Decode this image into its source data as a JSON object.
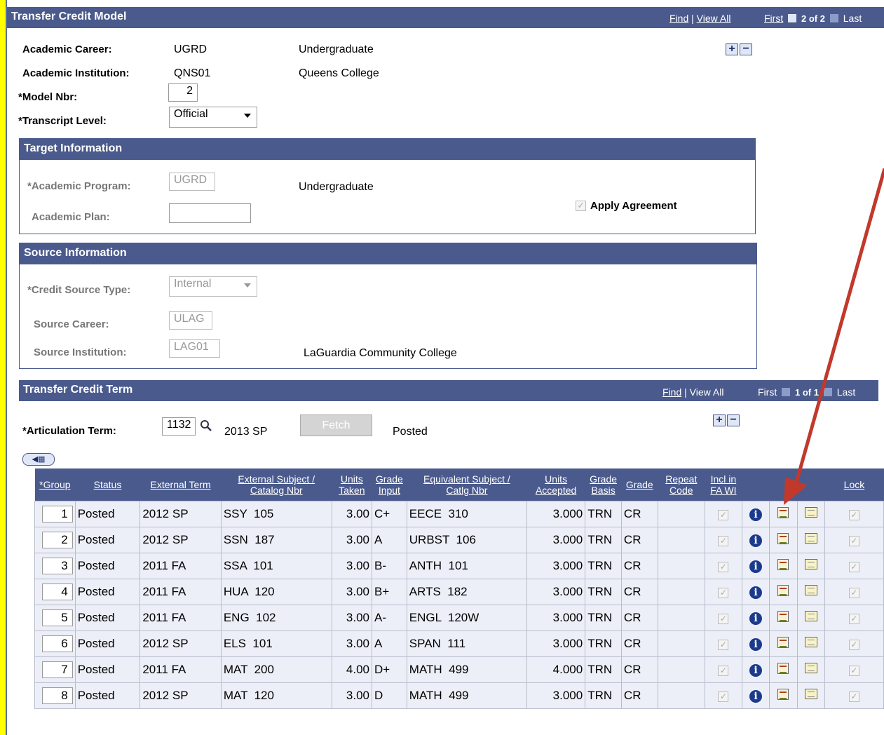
{
  "model": {
    "title": "Transfer Credit Model",
    "nav": {
      "find": "Find",
      "view_all": "View All",
      "first": "First",
      "position": "2 of 2",
      "last": "Last"
    },
    "career_label": "Academic Career:",
    "career_code": "UGRD",
    "career_desc": "Undergraduate",
    "institution_label": "Academic Institution:",
    "institution_code": "QNS01",
    "institution_desc": "Queens College",
    "model_nbr_label": "*Model Nbr:",
    "model_nbr": "2",
    "transcript_label": "*Transcript Level:",
    "transcript_value": "Official"
  },
  "target": {
    "title": "Target Information",
    "program_label": "*Academic Program:",
    "program_code": "UGRD",
    "program_desc": "Undergraduate",
    "plan_label": "Academic Plan:",
    "plan_value": "",
    "apply_label": "Apply Agreement"
  },
  "source": {
    "title": "Source Information",
    "type_label": "*Credit Source Type:",
    "type_value": "Internal",
    "career_label": "Source Career:",
    "career_value": "ULAG",
    "institution_label": "Source Institution:",
    "institution_value": "LAG01",
    "institution_desc": "LaGuardia Community College"
  },
  "term": {
    "title": "Transfer Credit Term",
    "nav": {
      "find": "Find",
      "view_all": "View All",
      "first": "First",
      "position": "1 of 1",
      "last": "Last"
    },
    "articulation_label": "*Articulation Term:",
    "articulation_value": "1132",
    "term_desc": "2013 SP",
    "fetch_label": "Fetch",
    "status": "Posted"
  },
  "grid": {
    "headers": {
      "group": "*Group",
      "status": "Status",
      "ext_term": "External Term",
      "ext_subject_1": "External Subject /",
      "ext_subject_2": "Catalog Nbr",
      "units_1": "Units",
      "units_2": "Taken",
      "grade_input_1": "Grade",
      "grade_input_2": "Input",
      "equiv_1": "Equivalent Subject /",
      "equiv_2": "Catlg Nbr",
      "units_acc_1": "Units",
      "units_acc_2": "Accepted",
      "grade_basis_1": "Grade",
      "grade_basis_2": "Basis",
      "grade": "Grade",
      "repeat_1": "Repeat",
      "repeat_2": "Code",
      "incl_1": "Incl in",
      "incl_2": "FA WI",
      "lock": "Lock"
    },
    "rows": [
      {
        "group": "1",
        "status": "Posted",
        "term": "2012 SP",
        "ext": "SSY  105",
        "units": "3.00",
        "grade_input": "C+",
        "equiv": "EECE  310",
        "accepted": "3.000",
        "basis": "TRN",
        "grade": "CR"
      },
      {
        "group": "2",
        "status": "Posted",
        "term": "2012 SP",
        "ext": "SSN  187",
        "units": "3.00",
        "grade_input": "A",
        "equiv": "URBST  106",
        "accepted": "3.000",
        "basis": "TRN",
        "grade": "CR"
      },
      {
        "group": "3",
        "status": "Posted",
        "term": "2011 FA",
        "ext": "SSA  101",
        "units": "3.00",
        "grade_input": "B-",
        "equiv": "ANTH  101",
        "accepted": "3.000",
        "basis": "TRN",
        "grade": "CR"
      },
      {
        "group": "4",
        "status": "Posted",
        "term": "2011 FA",
        "ext": "HUA  120",
        "units": "3.00",
        "grade_input": "B+",
        "equiv": "ARTS  182",
        "accepted": "3.000",
        "basis": "TRN",
        "grade": "CR"
      },
      {
        "group": "5",
        "status": "Posted",
        "term": "2011 FA",
        "ext": "ENG  102",
        "units": "3.00",
        "grade_input": "A-",
        "equiv": "ENGL  120W",
        "accepted": "3.000",
        "basis": "TRN",
        "grade": "CR"
      },
      {
        "group": "6",
        "status": "Posted",
        "term": "2012 SP",
        "ext": "ELS  101",
        "units": "3.00",
        "grade_input": "A",
        "equiv": "SPAN  111",
        "accepted": "3.000",
        "basis": "TRN",
        "grade": "CR"
      },
      {
        "group": "7",
        "status": "Posted",
        "term": "2011 FA",
        "ext": "MAT  200",
        "units": "4.00",
        "grade_input": "D+",
        "equiv": "MATH  499",
        "accepted": "4.000",
        "basis": "TRN",
        "grade": "CR"
      },
      {
        "group": "8",
        "status": "Posted",
        "term": "2012 SP",
        "ext": "MAT  120",
        "units": "3.00",
        "grade_input": "D",
        "equiv": "MATH  499",
        "accepted": "3.000",
        "basis": "TRN",
        "grade": "CR"
      }
    ]
  },
  "colors": {
    "header_bg": "#4a5a8c",
    "row_bg": "#eceff7",
    "annotation_arrow": "#c0392b",
    "background": "#ffff00"
  }
}
